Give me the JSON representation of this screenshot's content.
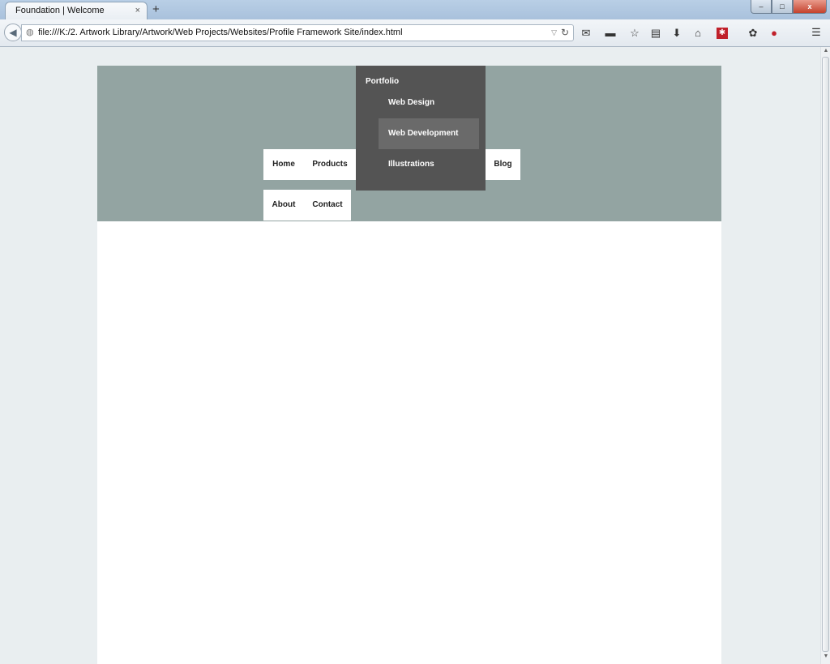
{
  "browser": {
    "tab_title": "Foundation | Welcome",
    "tab_close": "×",
    "new_tab": "+",
    "url": "file:///K:/2. Artwork Library/Artwork/Web Projects/Websites/Profile Framework Site/index.html",
    "window_buttons": {
      "minimize": "–",
      "maximize": "□",
      "close": "x"
    },
    "toolbar_icons": [
      "mail-icon",
      "addon-icon",
      "bookmark-star-icon",
      "reading-list-icon",
      "download-icon",
      "home-icon",
      "extension-icon",
      "puzzle-icon",
      "adblock-icon",
      "menu-icon"
    ]
  },
  "site": {
    "colors": {
      "header": "#93a4a2",
      "dropdown": "#545454",
      "dropdown_hover": "#6a6a6a",
      "page": "#ffffff"
    },
    "nav": {
      "home": "Home",
      "products": "Products",
      "portfolio": "Portfolio",
      "blog": "Blog",
      "about": "About",
      "contact": "Contact"
    },
    "portfolio_menu": [
      "Web Design",
      "Web Development",
      "Illustrations"
    ]
  }
}
